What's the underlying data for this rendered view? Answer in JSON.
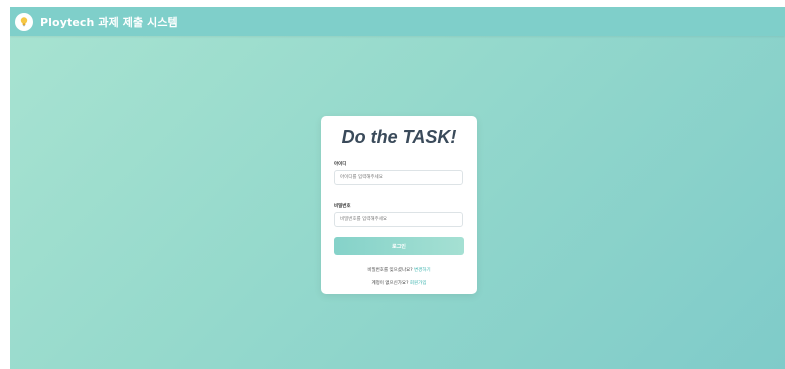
{
  "app": {
    "title": "Ploytech 과제 제출 시스템",
    "accent": "#7fcfca"
  },
  "login": {
    "title": "Do the TASK!",
    "id_label": "아이디",
    "id_placeholder": "아이디를 입력해주세요",
    "pw_label": "비밀번호",
    "pw_placeholder": "비밀번호를 입력해주세요",
    "login_button": "로그인",
    "forgot_text": "비밀번호를 잊으셨나요?",
    "forgot_link": "변경하기",
    "signup_text": "계정이 없으신가요?",
    "signup_link": "회원가입"
  },
  "icons": {
    "logo": "lightbulb-icon"
  }
}
